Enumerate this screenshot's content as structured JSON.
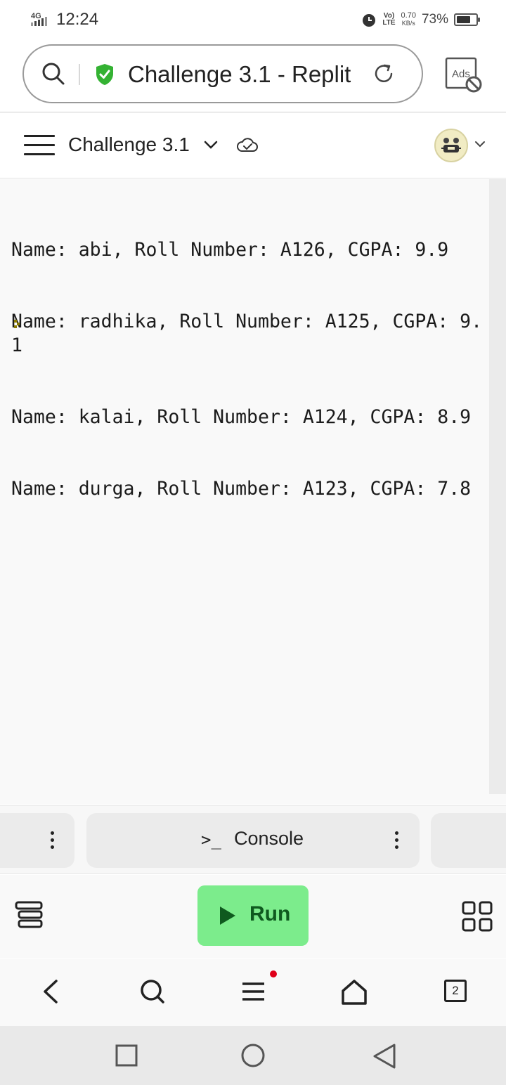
{
  "status_bar": {
    "network": "4G",
    "time": "12:24",
    "volte": "Vo)",
    "lte": "LTE",
    "speed_value": "0.70",
    "speed_unit": "KB/s",
    "battery": "73%",
    "battery_level": 0.73
  },
  "browser": {
    "page_title": "Challenge 3.1 - Replit",
    "ads_label": "Ads",
    "tab_count": "2"
  },
  "replit_header": {
    "repl_name": "Challenge 3.1"
  },
  "console": {
    "output_lines": [
      "Name: abi, Roll Number: A126, CGPA: 9.9",
      "Name: radhika, Roll Number: A125, CGPA: 9.1",
      "Name: kalai, Roll Number: A124, CGPA: 8.9",
      "Name: durga, Roll Number: A123, CGPA: 7.8"
    ]
  },
  "tabs": {
    "main_icon": ">_",
    "main_label": "Console"
  },
  "toolbar": {
    "run_label": "Run"
  },
  "colors": {
    "run_button": "#7cec8c",
    "shield": "#34b233",
    "notification_dot": "#e0001a",
    "prompt": "#8a7a00"
  },
  "icons": [
    "search-icon",
    "shield-check-icon",
    "reload-icon",
    "ads-block-icon",
    "hamburger-icon",
    "chevron-down-icon",
    "cloud-check-icon",
    "avatar-icon",
    "kebab-icon",
    "terminal-icon",
    "play-icon",
    "layers-icon",
    "grid-icon",
    "back-icon",
    "home-icon",
    "menu-icon",
    "tabs-icon",
    "recent-apps-icon",
    "system-home-icon",
    "system-back-icon"
  ]
}
